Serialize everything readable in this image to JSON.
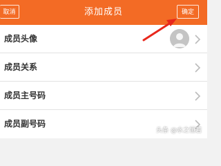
{
  "header": {
    "cancel_label": "取消",
    "title": "添加成员",
    "confirm_label": "确定"
  },
  "rows": [
    {
      "label": "成员头像"
    },
    {
      "label": "成员关系"
    },
    {
      "label": "成员主号码"
    },
    {
      "label": "成员副号码"
    }
  ],
  "watermark": "头条 @水之恒若",
  "colors": {
    "accent": "#f36b25",
    "annotation_arrow": "#e8271c"
  }
}
